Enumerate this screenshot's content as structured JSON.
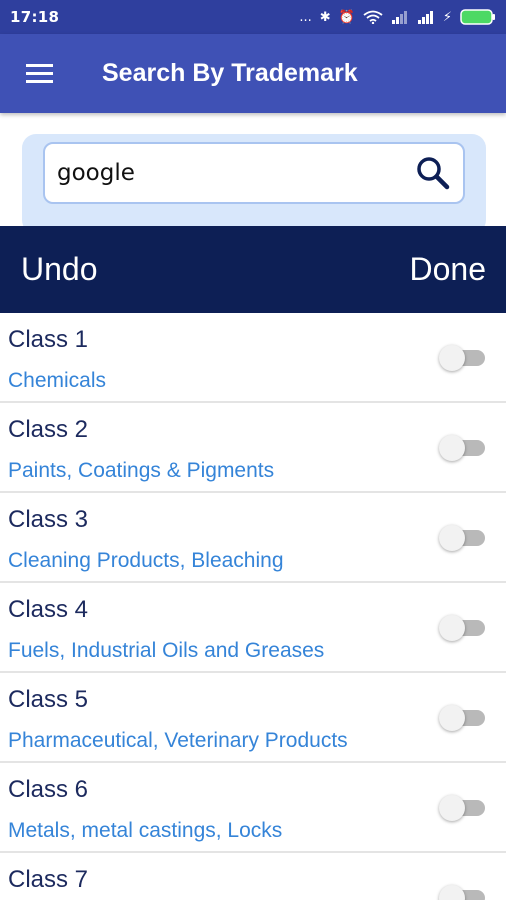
{
  "status_bar": {
    "time": "17:18",
    "icons": [
      "more-dots-icon",
      "bluetooth-icon",
      "alarm-icon",
      "wifi-icon",
      "signal-icon",
      "signal-icon",
      "charging-icon",
      "battery-icon"
    ],
    "dots": "...",
    "bluetooth_glyph": "✱",
    "alarm_glyph": "⏰",
    "charging_glyph": "⚡"
  },
  "app_bar": {
    "title": "Search By Trademark"
  },
  "search": {
    "value": "google"
  },
  "actions": {
    "undo_label": "Undo",
    "done_label": "Done"
  },
  "classes": [
    {
      "name": "Class 1",
      "description": "Chemicals",
      "enabled": false
    },
    {
      "name": "Class 2",
      "description": "Paints, Coatings & Pigments",
      "enabled": false
    },
    {
      "name": "Class 3",
      "description": "Cleaning Products, Bleaching",
      "enabled": false
    },
    {
      "name": "Class 4",
      "description": "Fuels, Industrial Oils and Greases",
      "enabled": false
    },
    {
      "name": "Class 5",
      "description": "Pharmaceutical, Veterinary Products",
      "enabled": false
    },
    {
      "name": "Class 6",
      "description": "Metals, metal castings, Locks",
      "enabled": false
    },
    {
      "name": "Class 7",
      "description": "",
      "enabled": false
    }
  ],
  "colors": {
    "status_bar": "#2f3f9e",
    "app_bar": "#3f51b5",
    "action_bar": "#0d1f55",
    "search_panel": "#d8e7fb",
    "class_name": "#1c2a5e",
    "class_desc": "#3584d8",
    "battery": "#4cd964"
  }
}
